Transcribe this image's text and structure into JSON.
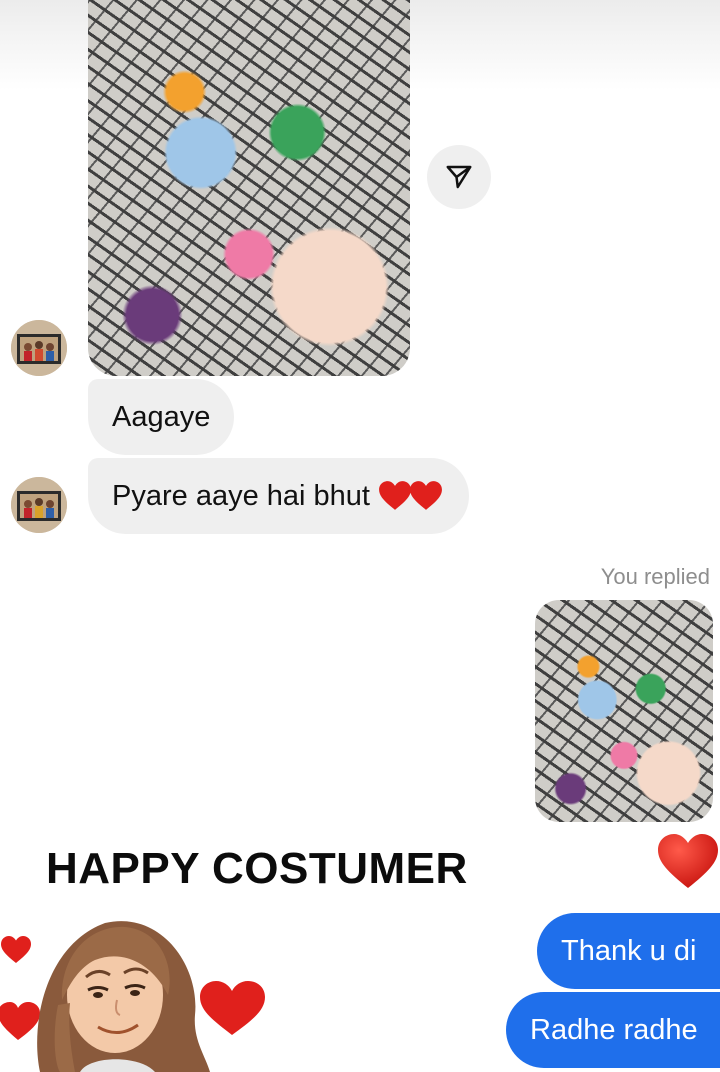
{
  "thread": {
    "incoming": [
      {
        "text": "Aagaye"
      },
      {
        "text": "Pyare aaye hai bhut"
      }
    ],
    "reply_label": "You replied",
    "outgoing": [
      {
        "text": "Thank u di"
      },
      {
        "text": "Radhe radhe"
      }
    ]
  },
  "overlay": {
    "caption": "HAPPY COSTUMER"
  },
  "icons": {
    "share": "send-icon",
    "heart": "heart-icon",
    "sticker": "girl-avatar-sticker-icon"
  },
  "colors": {
    "outgoing_bubble": "#1f6feb",
    "incoming_bubble": "#efefef",
    "heart": "#e0201c"
  }
}
